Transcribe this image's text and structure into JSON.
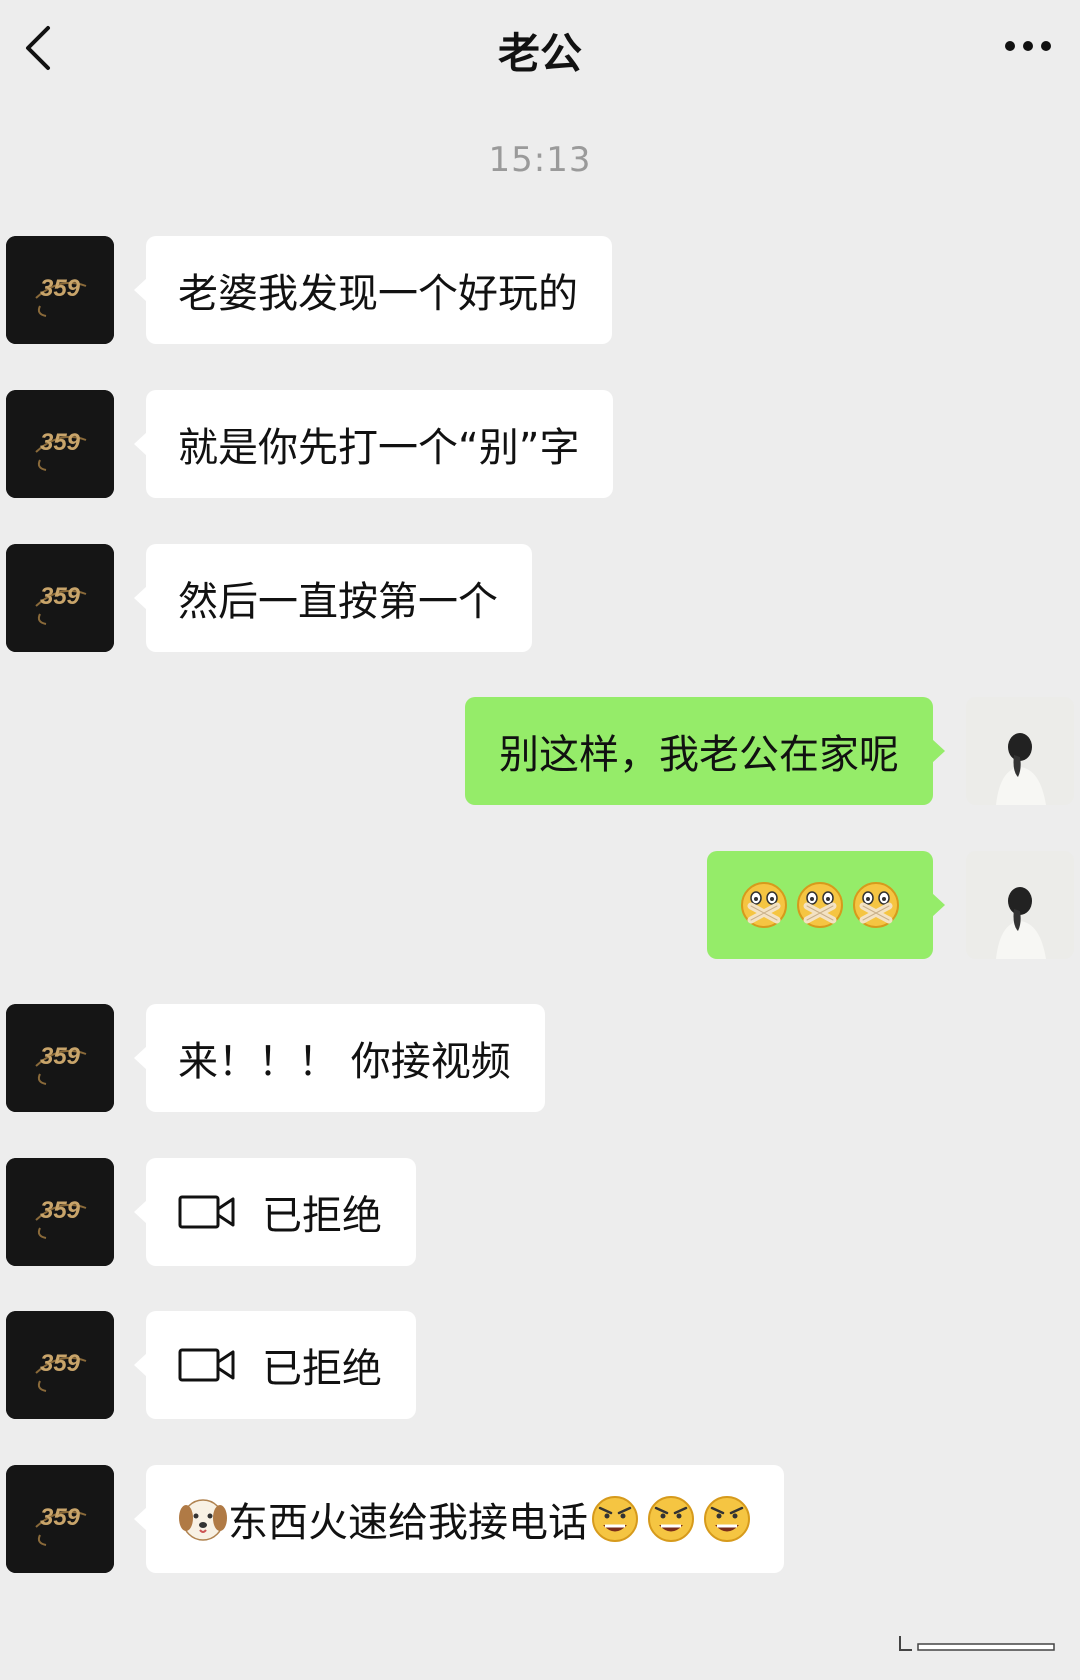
{
  "header": {
    "title": "老公",
    "back_icon": "chevron-left-icon",
    "more_icon": "more-dots-icon"
  },
  "timestamp": "15:13",
  "contact_avatar_text": "359",
  "messages": [
    {
      "side": "left",
      "text": "老婆我发现一个好玩的"
    },
    {
      "side": "left",
      "text": "就是你先打一个“别”字"
    },
    {
      "side": "left",
      "text": "然后一直按第一个"
    },
    {
      "side": "right",
      "text": "别这样，我老公在家呢"
    },
    {
      "side": "right",
      "emojis": [
        "zipped-mouth-emoji",
        "zipped-mouth-emoji",
        "zipped-mouth-emoji"
      ]
    },
    {
      "side": "left",
      "text": "来！！！ 你接视频"
    },
    {
      "side": "left",
      "icon": "video-call-icon",
      "text": "已拒绝"
    },
    {
      "side": "left",
      "icon": "video-call-icon",
      "text": "已拒绝"
    },
    {
      "side": "left",
      "prefix_emoji": "dog-face-emoji",
      "text": "东西火速给我接电话",
      "suffix_emojis": [
        "angry-face-emoji",
        "angry-face-emoji",
        "angry-face-emoji"
      ]
    }
  ],
  "colors": {
    "background": "#ededed",
    "bubble_sent": "#95ec69",
    "bubble_received": "#ffffff",
    "avatar_contact": "#151515",
    "avatar_logo": "#c8a46a"
  }
}
